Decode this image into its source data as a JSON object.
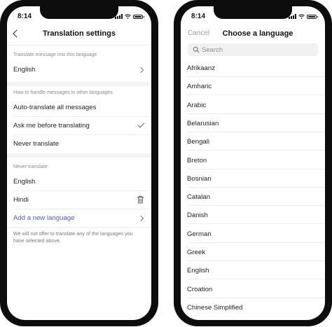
{
  "status": {
    "time": "8:14"
  },
  "settings": {
    "title": "Translation settings",
    "translate_into": {
      "header": "Translate message into this language",
      "value": "English"
    },
    "handling": {
      "header": "How to handle messages in other languages",
      "options": [
        {
          "label": "Auto-translate all messages",
          "selected": false
        },
        {
          "label": "Ask me before translating",
          "selected": true
        },
        {
          "label": "Never translate",
          "selected": false
        }
      ]
    },
    "never_translate": {
      "header": "Never translate",
      "languages": [
        "English",
        "Hindi"
      ],
      "add_label": "Add a new language"
    },
    "footnote": "We will not offer to translate any of the languages you have selected above."
  },
  "picker": {
    "cancel_label": "Cancel",
    "title": "Choose a language",
    "search_placeholder": "Search",
    "languages": [
      "Afrikaanz",
      "Amharic",
      "Arabic",
      "Belarusian",
      "Bengali",
      "Breton",
      "Bosnian",
      "Catalan",
      "Danish",
      "German",
      "Greek",
      "English",
      "Croation",
      "Chinese Simplified"
    ]
  },
  "colors": {
    "link": "#4f5aa8",
    "phone_frame": "#0d0d0d",
    "muted_text": "#8a8a8a"
  },
  "icons": [
    "back-chevron-icon",
    "chevron-right-icon",
    "checkmark-icon",
    "trash-icon",
    "search-icon",
    "signal-icon",
    "wifi-icon",
    "battery-icon"
  ]
}
